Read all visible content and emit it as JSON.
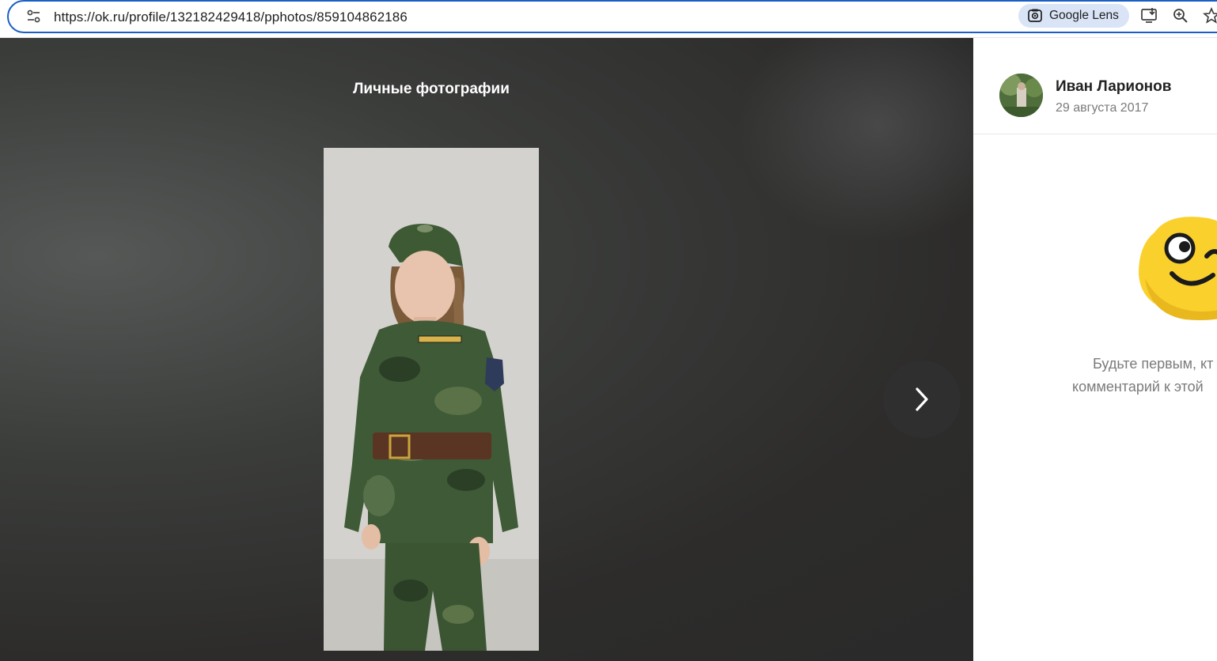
{
  "browser": {
    "url": "https://ok.ru/profile/132182429418/pphotos/859104862186",
    "lens_label": "Google Lens",
    "icons": [
      "site-info-icon",
      "google-lens-icon",
      "install-app-icon",
      "zoom-icon",
      "bookmark-star-icon"
    ]
  },
  "viewer": {
    "album_title": "Личные фотографии",
    "next_icon": "chevron-right-icon"
  },
  "sidebar": {
    "author_name": "Иван Ларионов",
    "date": "29 августа 2017",
    "empty_comments_line1": "Будьте первым, кт",
    "empty_comments_line2": "комментарий к этой",
    "mascot_icon": "winking-smile-mascot"
  },
  "colors": {
    "omnibox_border": "#1a5fc4",
    "lens_chip": "#d9e4f6",
    "viewer_bg": "#2d2c2b",
    "mascot_yellow": "#fad02c"
  }
}
